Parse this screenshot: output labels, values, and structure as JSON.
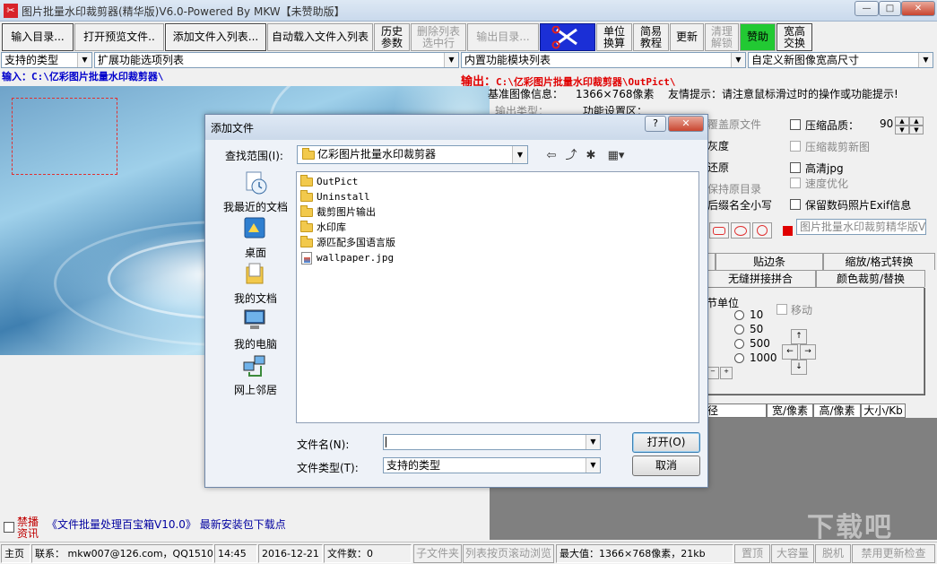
{
  "window": {
    "title": "图片批量水印裁剪器(精华版)V6.0-Powered By MKW【未赞助版】",
    "minimize": "—",
    "maximize": "□",
    "close": "✕"
  },
  "toolbar": {
    "open_dir": "输入目录...",
    "open_preview": "打开预览文件..",
    "add_to_list": "添加文件入列表...",
    "auto_load": "自动载入文件入列表",
    "history_1": "历史",
    "history_2": "参数",
    "delete_1": "删除列表",
    "delete_2": "选中行",
    "output_dir": "输出目录...",
    "unit_1": "单位",
    "unit_2": "换算",
    "tutorial_1": "简易",
    "tutorial_2": "教程",
    "update": "更新",
    "unlock_1": "清理",
    "unlock_2": "解锁",
    "sponsor": "赞助",
    "wh_1": "宽高",
    "wh_2": "交换"
  },
  "selects": {
    "types": "支持的类型",
    "ext_options": "扩展功能选项列表",
    "modules": "内置功能模块列表",
    "custom_size": "自定义新图像宽高尺寸"
  },
  "paths": {
    "input": "输入：C:\\亿彩图片批量水印裁剪器\\",
    "output_label": "输出：",
    "output": "C:\\亿彩图片批量水印裁剪器\\OutPict\\"
  },
  "info": {
    "base_label": "基准图像信息：",
    "base_value": "1366×768像素",
    "tip": "友情提示：请注意鼠标滑过时的操作或功能提示!",
    "output_type": "输出类型：",
    "func_area": "功能设置区："
  },
  "options": {
    "overwrite": "覆盖原文件",
    "gray": "灰度",
    "restore": "还原",
    "keep_dir": "保持原目录",
    "lowercase": "后缀名全小写",
    "compress_quality": "压缩品质：",
    "quality_value": "90",
    "compress_new": "压缩裁剪新图",
    "hq_jpg": "高清jpg",
    "speed_opt": "速度优化",
    "keep_exif": "保留数码照片Exif信息",
    "watermark_text": "图片批量水印裁剪精华版V"
  },
  "tabs": {
    "row1": [
      "贴边条",
      "缩放/格式转换"
    ],
    "row2": [
      "无缝拼接拼合",
      "颜色裁剪/替换"
    ]
  },
  "move_panel": {
    "unit_label": "节单位",
    "move": "移动",
    "steps": [
      "10",
      "50",
      "500",
      "1000"
    ]
  },
  "table": {
    "columns": [
      "径",
      "宽/像素",
      "高/像素",
      "大小/Kb"
    ]
  },
  "dialog": {
    "title": "添加文件",
    "help": "?",
    "close": "✕",
    "look_in_label": "查找范围(I):",
    "look_in_value": "亿彩图片批量水印裁剪器",
    "places": [
      "我最近的文档",
      "桌面",
      "我的文档",
      "我的电脑",
      "网上邻居"
    ],
    "files": [
      {
        "name": "OutPict",
        "type": "folder"
      },
      {
        "name": "Uninstall",
        "type": "folder"
      },
      {
        "name": "裁剪图片输出",
        "type": "folder"
      },
      {
        "name": "水印库",
        "type": "folder"
      },
      {
        "name": "源匹配多国语言版",
        "type": "folder"
      },
      {
        "name": "wallpaper.jpg",
        "type": "image"
      }
    ],
    "filename_label": "文件名(N):",
    "filename_value": "",
    "filetype_label": "文件类型(T):",
    "filetype_value": "支持的类型",
    "open": "打开(O)",
    "cancel": "取消"
  },
  "news": {
    "block_1": "禁播",
    "block_2": "资讯",
    "link": "《文件批量处理百宝箱V10.0》 最新安装包下载点"
  },
  "status": {
    "home": "主页",
    "contact": "联系：  mkw007@126.com，QQ15104946",
    "time": "14:45",
    "date": "2016-12-21",
    "files": "文件数：0",
    "subfolder": "子文件夹",
    "scroll_view": "列表按页滚动浏览",
    "max": "最大值：1366×768像素，21kb",
    "top": "置顶",
    "big": "大容量",
    "offline": "脱机",
    "no_update": "禁用更新检查"
  },
  "watermark": "下载吧"
}
